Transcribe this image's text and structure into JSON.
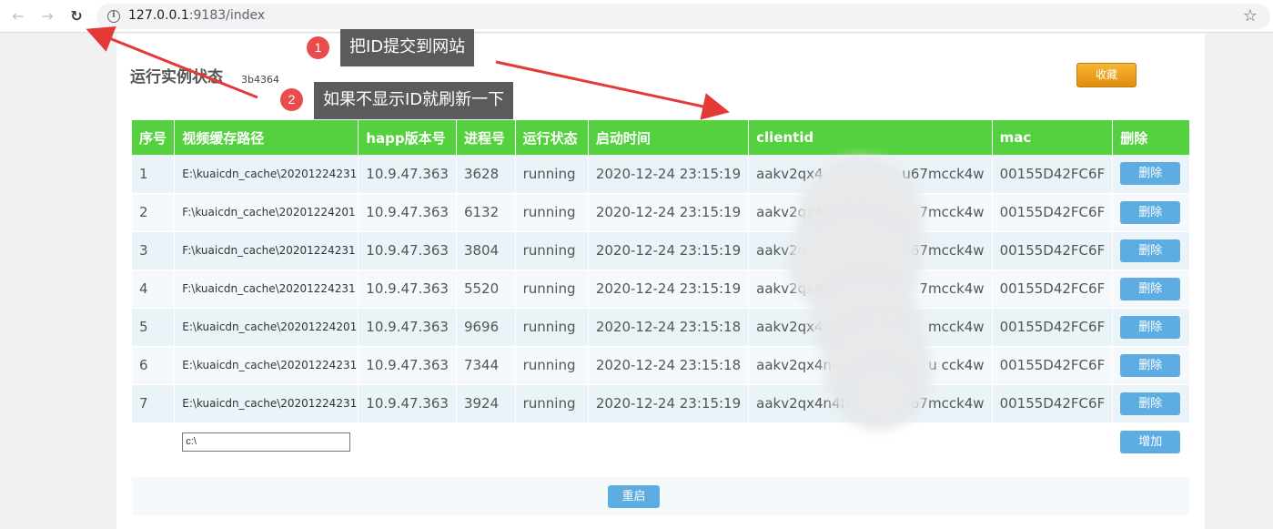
{
  "browser": {
    "url_host": "127.0.0.1",
    "url_rest": ":9183/index",
    "back_icon": "←",
    "forward_icon": "→",
    "reload_icon": "↻",
    "info_icon": "i",
    "star_icon": "☆"
  },
  "page": {
    "title": "运行实例状态",
    "instance_id": "3b4364",
    "collapse_label": "收藏"
  },
  "table": {
    "headers": [
      "序号",
      "视频缓存路径",
      "happ版本号",
      "进程号",
      "运行状态",
      "启动时间",
      "clientid",
      "mac",
      "删除"
    ],
    "rows": [
      {
        "no": "1",
        "path": "E:\\kuaicdn_cache\\20201224231",
        "version": "10.9.47.363",
        "pid": "3628",
        "status": "running",
        "start": "2020-12-24 23:15:19",
        "clientid": "aakv2qx4",
        "clientid_tail": "u67mcck4w",
        "mac": "00155D42FC6F",
        "del": "删除"
      },
      {
        "no": "2",
        "path": "F:\\kuaicdn_cache\\20201224201",
        "version": "10.9.47.363",
        "pid": "6132",
        "status": "running",
        "start": "2020-12-24 23:15:19",
        "clientid": "aakv2qx4n",
        "clientid_tail": "7mcck4w",
        "mac": "00155D42FC6F",
        "del": "删除"
      },
      {
        "no": "3",
        "path": "F:\\kuaicdn_cache\\20201224231",
        "version": "10.9.47.363",
        "pid": "3804",
        "status": "running",
        "start": "2020-12-24 23:15:19",
        "clientid": "aakv2q",
        "clientid_tail": "u67mcck4w",
        "mac": "00155D42FC6F",
        "del": "删除"
      },
      {
        "no": "4",
        "path": "F:\\kuaicdn_cache\\20201224231",
        "version": "10.9.47.363",
        "pid": "5520",
        "status": "running",
        "start": "2020-12-24 23:15:19",
        "clientid": "aakv2qx4n",
        "clientid_tail": "7mcck4w",
        "mac": "00155D42FC6F",
        "del": "删除"
      },
      {
        "no": "5",
        "path": "E:\\kuaicdn_cache\\20201224201",
        "version": "10.9.47.363",
        "pid": "9696",
        "status": "running",
        "start": "2020-12-24 23:15:18",
        "clientid": "aakv2qx4r",
        "clientid_tail": "mcck4w",
        "mac": "00155D42FC6F",
        "del": "删除"
      },
      {
        "no": "6",
        "path": "E:\\kuaicdn_cache\\20201224231",
        "version": "10.9.47.363",
        "pid": "7344",
        "status": "running",
        "start": "2020-12-24 23:15:18",
        "clientid": "aakv2qx4n4f",
        "clientid_tail": "u   cck4w",
        "mac": "00155D42FC6F",
        "del": "删除"
      },
      {
        "no": "7",
        "path": "E:\\kuaicdn_cache\\20201224231",
        "version": "10.9.47.363",
        "pid": "3924",
        "status": "running",
        "start": "2020-12-24 23:15:19",
        "clientid": "aakv2qx4n4f6",
        "clientid_tail": "u67mcck4w",
        "mac": "00155D42FC6F",
        "del": "删除"
      }
    ],
    "add_input_value": "c:\\",
    "add_label": "增加"
  },
  "restart_label": "重启",
  "annotations": {
    "one_number": "1",
    "one_text": "把ID提交到网站",
    "two_number": "2",
    "two_text": "如果不显示ID就刷新一下"
  },
  "colors": {
    "header_green": "#55d13f",
    "button_blue": "#5dade2",
    "collapse_orange": "#f0a020",
    "callout_grey": "#5b5b5b",
    "badge_red": "#e84c4c",
    "arrow_red": "#e53935"
  }
}
